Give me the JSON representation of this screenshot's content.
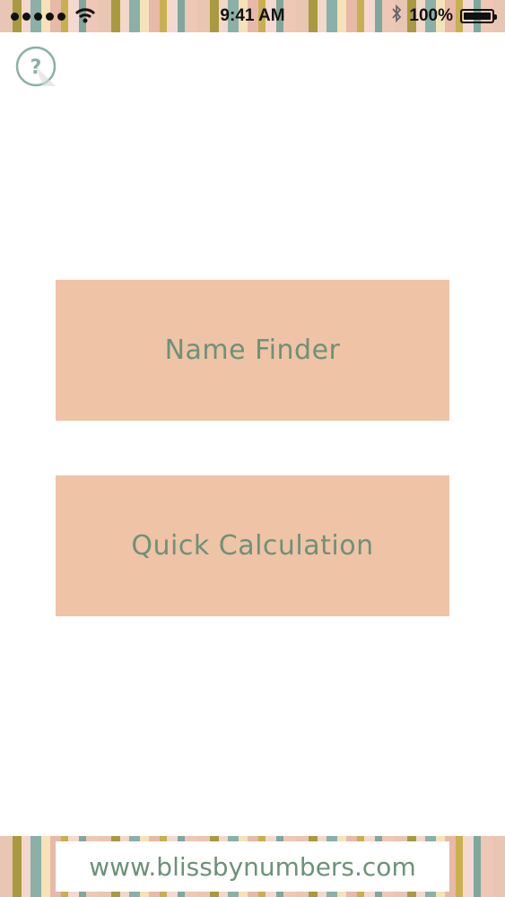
{
  "status_bar": {
    "time": "9:41 AM",
    "battery": "100%",
    "icons": [
      "signal-dots-icon",
      "wifi-icon",
      "bluetooth-icon",
      "battery-icon"
    ]
  },
  "header": {
    "help_icon": "question-mark-icon"
  },
  "main": {
    "buttons": [
      {
        "label": "Name Finder"
      },
      {
        "label": "Quick Calculation"
      }
    ]
  },
  "footer": {
    "website": "www.blissbynumbers.com"
  },
  "colors": {
    "accent_text": "#6e9178",
    "button_bg": "#efc3a6",
    "background": "#ffffff",
    "help_circle": "#8ab0a7"
  }
}
